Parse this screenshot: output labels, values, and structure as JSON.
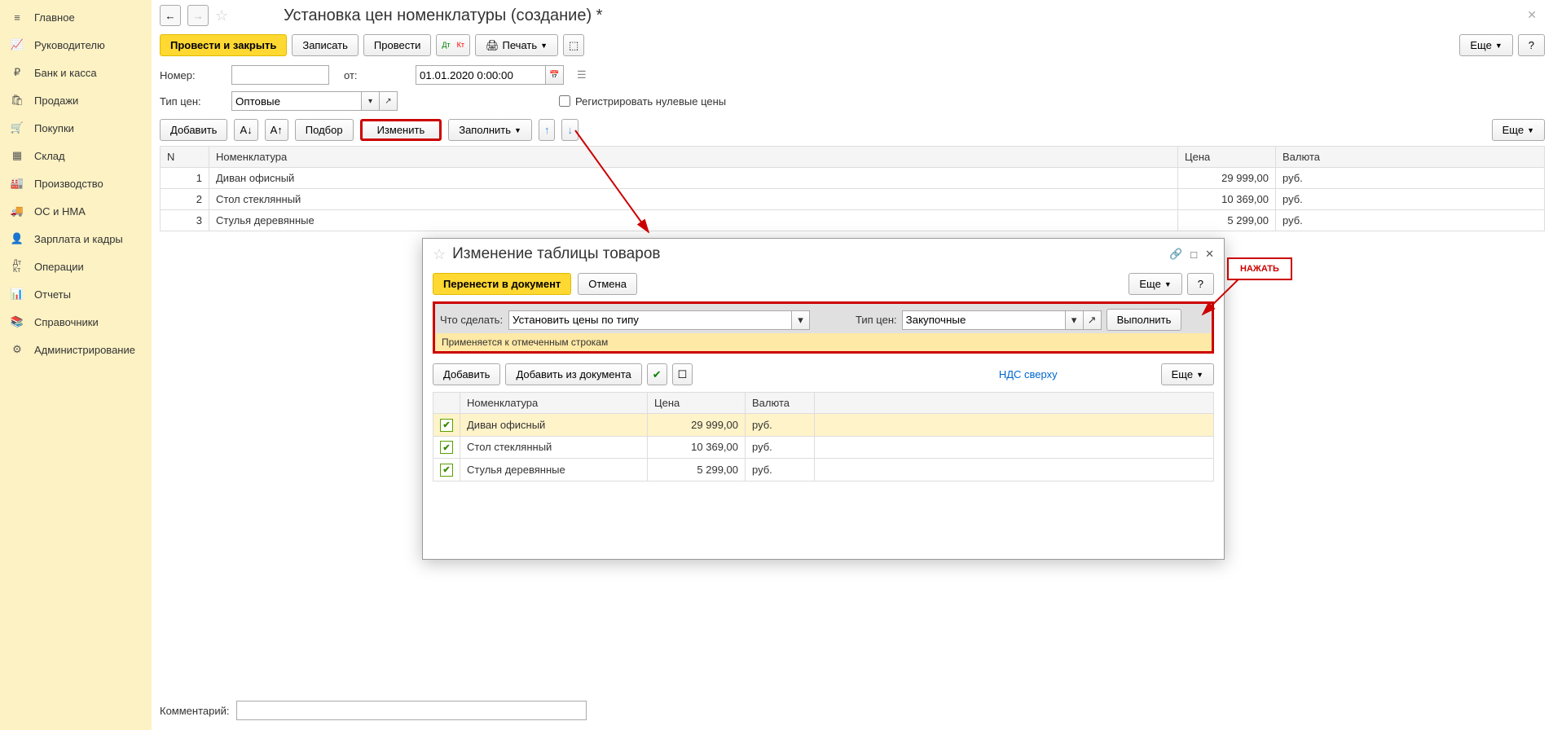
{
  "sidebar": {
    "items": [
      {
        "label": "Главное"
      },
      {
        "label": "Руководителю"
      },
      {
        "label": "Банк и касса"
      },
      {
        "label": "Продажи"
      },
      {
        "label": "Покупки"
      },
      {
        "label": "Склад"
      },
      {
        "label": "Производство"
      },
      {
        "label": "ОС и НМА"
      },
      {
        "label": "Зарплата и кадры"
      },
      {
        "label": "Операции"
      },
      {
        "label": "Отчеты"
      },
      {
        "label": "Справочники"
      },
      {
        "label": "Администрирование"
      }
    ]
  },
  "header": {
    "title": "Установка цен номенклатуры (создание) *"
  },
  "toolbar": {
    "post_close": "Провести и закрыть",
    "save": "Записать",
    "post": "Провести",
    "print": "Печать",
    "more": "Еще",
    "help": "?"
  },
  "fields": {
    "number_label": "Номер:",
    "from_label": "от:",
    "date_value": "01.01.2020 0:00:00",
    "price_type_label": "Тип цен:",
    "price_type_value": "Оптовые",
    "register_zero": "Регистрировать нулевые цены",
    "comment_label": "Комментарий:"
  },
  "table_toolbar": {
    "add": "Добавить",
    "pick": "Подбор",
    "change": "Изменить",
    "fill": "Заполнить",
    "more": "Еще"
  },
  "table": {
    "headers": {
      "n": "N",
      "nomenclature": "Номенклатура",
      "price": "Цена",
      "currency": "Валюта"
    },
    "rows": [
      {
        "n": "1",
        "name": "Диван офисный",
        "price": "29 999,00",
        "currency": "руб."
      },
      {
        "n": "2",
        "name": "Стол стеклянный",
        "price": "10 369,00",
        "currency": "руб."
      },
      {
        "n": "3",
        "name": "Стулья деревянные",
        "price": "5 299,00",
        "currency": "руб."
      }
    ]
  },
  "dialog": {
    "title": "Изменение таблицы товаров",
    "transfer": "Перенести в документ",
    "cancel": "Отмена",
    "more": "Еще",
    "help": "?",
    "what_label": "Что сделать:",
    "what_value": "Установить цены по типу",
    "price_type_label": "Тип цен:",
    "price_type_value": "Закупочные",
    "execute": "Выполнить",
    "note": "Применяется к отмеченным строкам",
    "tb_add": "Добавить",
    "tb_add_doc": "Добавить из документа",
    "vat": "НДС сверху",
    "tb_more": "Еще",
    "headers": {
      "nomenclature": "Номенклатура",
      "price": "Цена",
      "currency": "Валюта"
    },
    "rows": [
      {
        "name": "Диван офисный",
        "price": "29 999,00",
        "currency": "руб."
      },
      {
        "name": "Стол стеклянный",
        "price": "10 369,00",
        "currency": "руб."
      },
      {
        "name": "Стулья деревянные",
        "price": "5 299,00",
        "currency": "руб."
      }
    ]
  },
  "callout": {
    "press": "НАЖАТЬ"
  }
}
